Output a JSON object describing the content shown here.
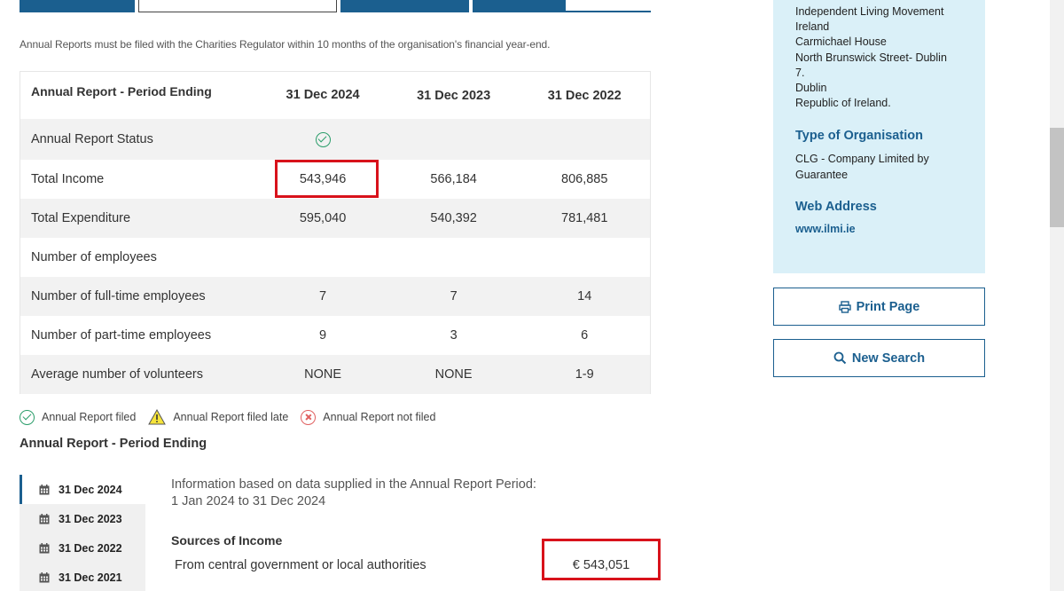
{
  "notice": "Annual Reports must be filed with the Charities Regulator within 10 months of the organisation's financial year-end.",
  "table": {
    "header_label": "Annual Report - Period Ending",
    "columns": [
      "31 Dec 2024",
      "31 Dec 2023",
      "31 Dec 2022"
    ],
    "rows": [
      {
        "label": "Annual Report Status",
        "values": [
          "filed",
          "",
          ""
        ]
      },
      {
        "label": "Total Income",
        "values": [
          "543,946",
          "566,184",
          "806,885"
        ]
      },
      {
        "label": "Total Expenditure",
        "values": [
          "595,040",
          "540,392",
          "781,481"
        ]
      },
      {
        "label": "Number of employees",
        "values": [
          "",
          "",
          ""
        ]
      },
      {
        "label": "Number of full-time employees",
        "values": [
          "7",
          "7",
          "14"
        ]
      },
      {
        "label": "Number of part-time employees",
        "values": [
          "9",
          "3",
          "6"
        ]
      },
      {
        "label": "Average number of volunteers",
        "values": [
          "NONE",
          "NONE",
          "1-9"
        ]
      }
    ]
  },
  "legend": {
    "filed": "Annual Report filed",
    "late": "Annual Report filed late",
    "not_filed": "Annual Report not filed"
  },
  "period_section_title": "Annual Report - Period Ending",
  "year_tabs": [
    "31 Dec 2024",
    "31 Dec 2023",
    "31 Dec 2022",
    "31 Dec 2021"
  ],
  "info": {
    "line1": "Information based on data supplied in the Annual Report Period:",
    "line2": "1 Jan 2024 to 31 Dec 2024"
  },
  "sources": {
    "title": "Sources of Income",
    "row_label": "From central government or local authorities",
    "row_value": "€ 543,051"
  },
  "sidebar": {
    "address_lines": [
      "Independent Living Movement",
      "Ireland",
      "Carmichael House",
      "North Brunswick Street- Dublin",
      "7.",
      "Dublin",
      "Republic of Ireland."
    ],
    "type_heading": "Type of Organisation",
    "type_value": "CLG - Company Limited by Guarantee",
    "web_heading": "Web Address",
    "web_value": "www.ilmi.ie",
    "print_label": "Print Page",
    "search_label": "New Search"
  },
  "colors": {
    "brand": "#1b5f8f",
    "highlight": "#d8121b",
    "filed": "#2a9d6a",
    "sidebar_bg": "#daf0f8"
  }
}
